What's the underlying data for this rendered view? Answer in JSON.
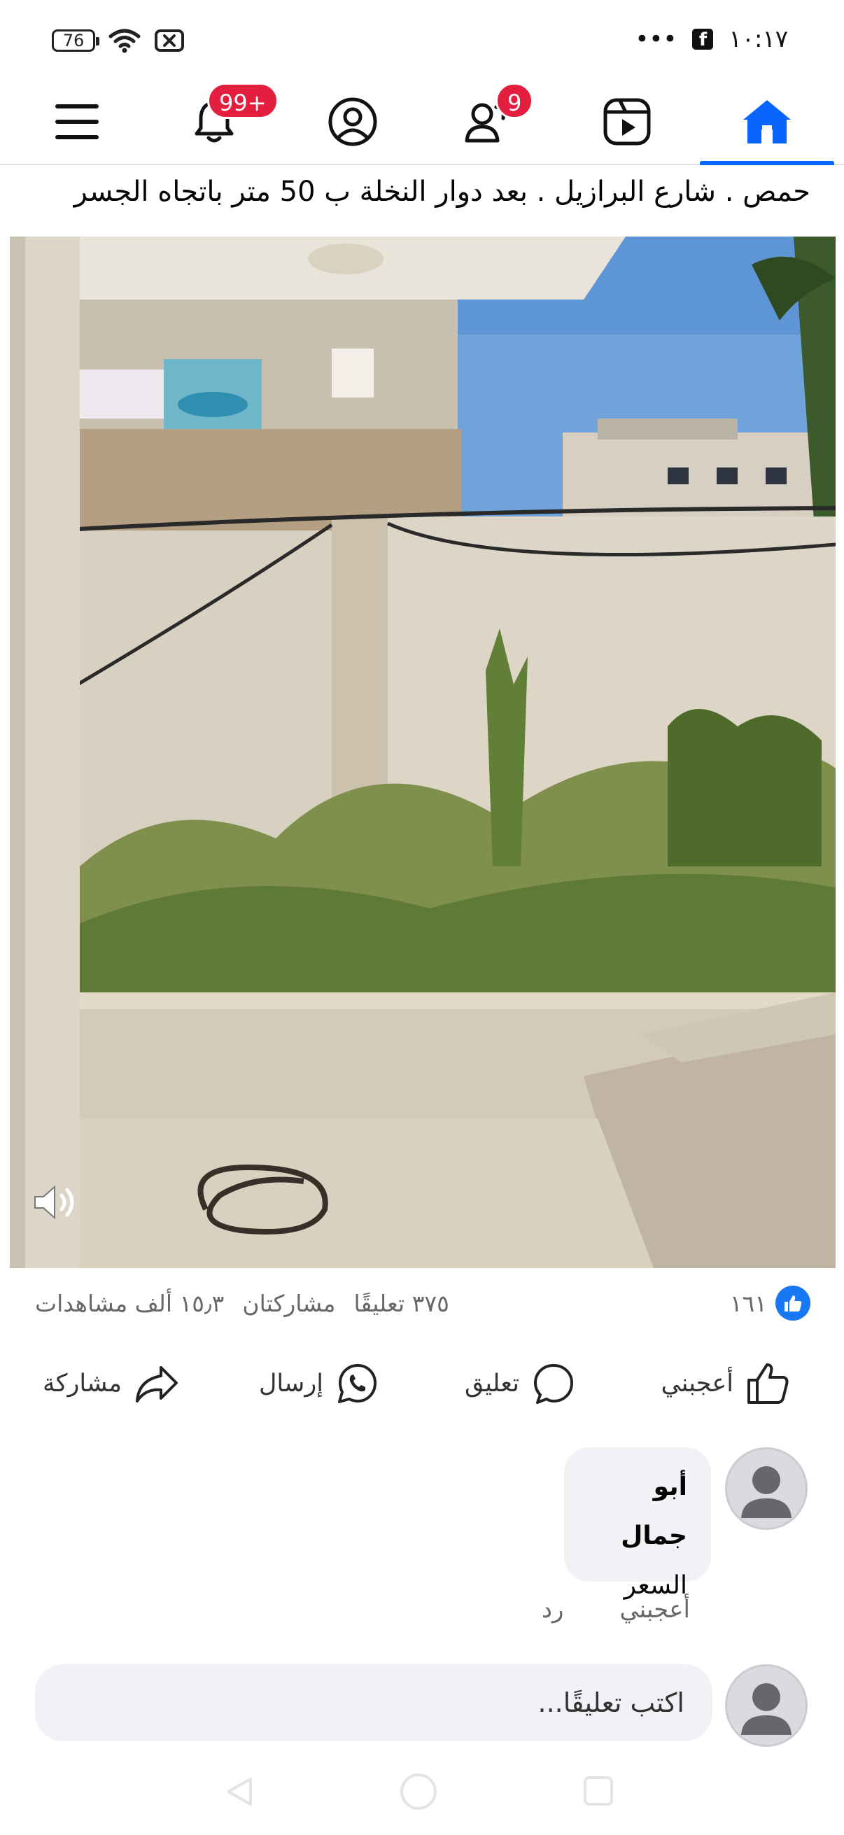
{
  "status_bar": {
    "battery": "76",
    "time": "١٠:١٧",
    "more": "•••",
    "app_icon": "f"
  },
  "nav": {
    "notifications_badge": "99+",
    "friends_badge": "9",
    "items": [
      "menu-icon",
      "bell-icon",
      "profile-icon",
      "friends-icon",
      "video-icon",
      "home-icon"
    ]
  },
  "post": {
    "caption": "حمص . شارع البرازيل . بعد دوار النخلة ب 50 متر باتجاه الجسر"
  },
  "stats": {
    "likes": "١٦١",
    "comments": "٣٧٥ تعليقًا",
    "shares": "مشاركتان",
    "views": "١٥٫٣ ألف مشاهدات"
  },
  "actions": {
    "like": "أعجبني",
    "comment": "تعليق",
    "send": "إرسال",
    "share": "مشاركة"
  },
  "comment": {
    "author": "أبو جمال",
    "text": "السعر",
    "like": "أعجبني",
    "reply": "رد"
  },
  "comment_input": {
    "placeholder": "اكتب تعليقًا..."
  },
  "colors": {
    "accent": "#0866ff",
    "badge": "#e41e3f",
    "bubble": "#f0f2f5"
  }
}
